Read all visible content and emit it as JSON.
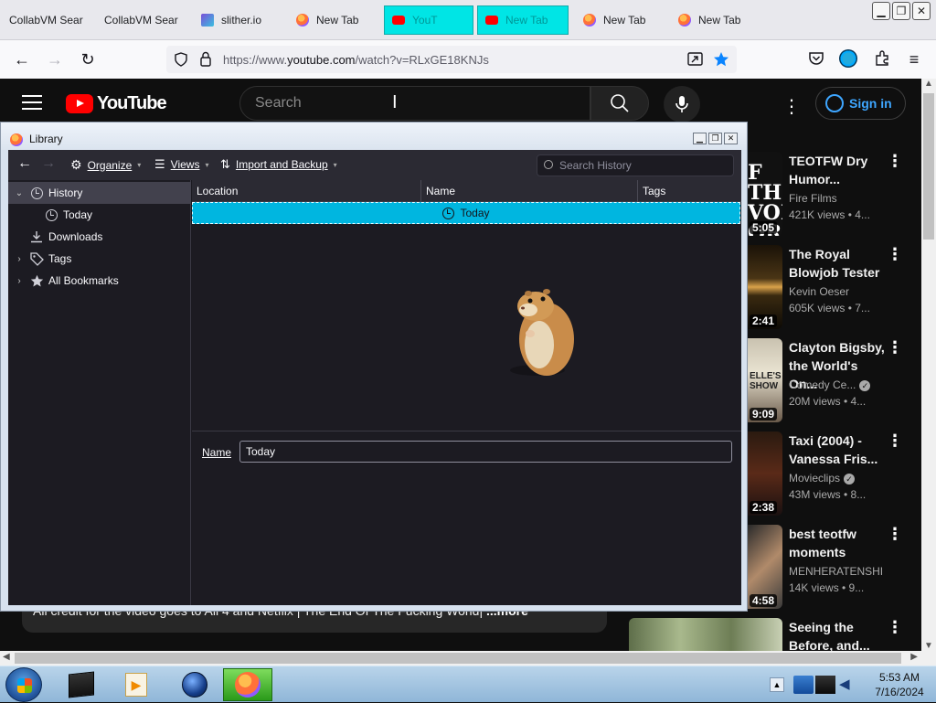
{
  "browser": {
    "tabs": [
      {
        "label": "CollabVM Sear",
        "icon": "none"
      },
      {
        "label": "CollabVM Sear",
        "icon": "none"
      },
      {
        "label": "slither.io",
        "icon": "slither-icon"
      },
      {
        "label": "New Tab",
        "icon": "firefox-icon"
      },
      {
        "label": "YouT",
        "icon": "youtube-icon"
      },
      {
        "label": "New Tab",
        "icon": "youtube-icon"
      },
      {
        "label": "New Tab",
        "icon": "firefox-icon"
      },
      {
        "label": "New Tab",
        "icon": "firefox-icon"
      }
    ],
    "url_prefix": "https://www.",
    "url_host": "youtube.com",
    "url_path": "/watch?v=RLxGE18KNJs"
  },
  "youtube": {
    "logo_text": "YouTube",
    "search_placeholder": "Search",
    "sign_in": "Sign in",
    "description": "All credit for the video goes to All 4 and Netflix | The End Of The Fucking World| ",
    "description_more": "...more",
    "videos": [
      {
        "title": "TEOTFW Dry Humor...",
        "channel": "Fire Films",
        "meta": "421K views • 4...",
        "duration": "5:05",
        "verified": false
      },
      {
        "title": "The Royal Blowjob Tester",
        "channel": "Kevin Oeser",
        "meta": "605K views • 7...",
        "duration": "2:41",
        "verified": false
      },
      {
        "title": "Clayton Bigsby, the World's On...",
        "channel": "Comedy Ce...",
        "meta": "20M views • 4...",
        "duration": "9:09",
        "verified": true
      },
      {
        "title": "Taxi (2004) -Vanessa Fris...",
        "channel": "Movieclips",
        "meta": "43M views • 8...",
        "duration": "2:38",
        "verified": true
      },
      {
        "title": "best teotfw moments",
        "channel": "MENHERATENSHI",
        "meta": "14K views • 9...",
        "duration": "4:58",
        "verified": false
      },
      {
        "title": "Seeing the Before, and...",
        "channel": "",
        "meta": "",
        "duration": "",
        "verified": false
      }
    ]
  },
  "library": {
    "title": "Library",
    "toolbar": {
      "organize": "Organize",
      "views": "Views",
      "import_backup": "Import and Backup",
      "search_placeholder": "Search History"
    },
    "tree": [
      {
        "label": "History",
        "icon": "clock-icon",
        "expanded": true,
        "selected": true
      },
      {
        "label": "Today",
        "icon": "clock-icon"
      },
      {
        "label": "Downloads",
        "icon": "download-icon"
      },
      {
        "label": "Tags",
        "icon": "tag-icon"
      },
      {
        "label": "All Bookmarks",
        "icon": "star-icon"
      }
    ],
    "columns": [
      "Location",
      "Name",
      "Tags"
    ],
    "rows": [
      {
        "name": "Today"
      }
    ],
    "details": {
      "name_label": "Name",
      "name_value": "Today"
    }
  },
  "taskbar": {
    "time": "5:53 AM",
    "date": "7/16/2024"
  },
  "colors": {
    "youtube_red": "#ff0000",
    "library_selection": "#00b6e0",
    "link_blue": "#3ea6ff"
  }
}
